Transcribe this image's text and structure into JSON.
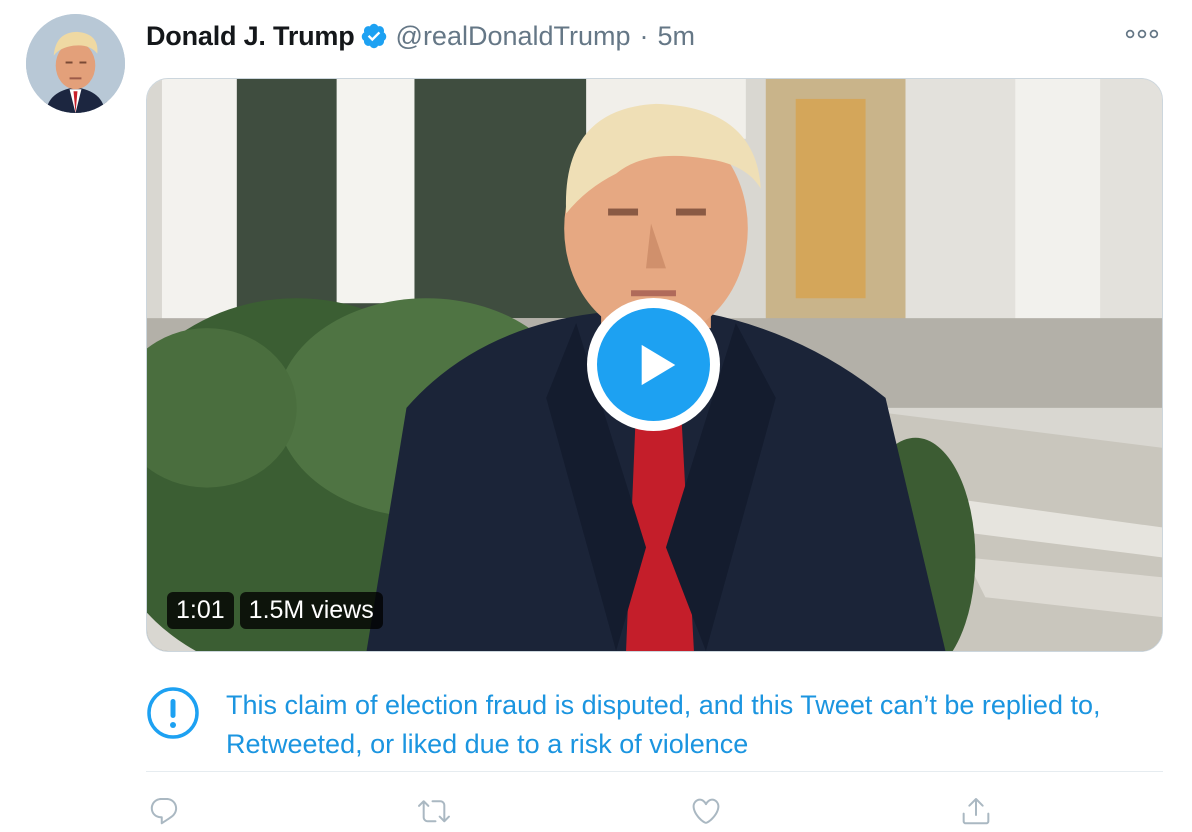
{
  "author": {
    "display_name": "Donald J. Trump",
    "handle": "@realDonaldTrump",
    "separator": "·",
    "time": "5m",
    "verified_icon": "verified-badge-icon"
  },
  "media": {
    "duration": "1:01",
    "views": "1.5M views",
    "play_icon": "play-icon"
  },
  "notice": {
    "icon": "exclamation-circle-icon",
    "text": "This claim of election fraud is disputed, and this Tweet can’t be replied to, Retweeted, or liked due to a risk of violence"
  },
  "actions": [
    {
      "icon": "reply-icon"
    },
    {
      "icon": "retweet-icon"
    },
    {
      "icon": "like-icon"
    },
    {
      "icon": "share-icon"
    }
  ],
  "colors": {
    "brand_blue": "#1da1f2",
    "link_blue": "#1b95e0",
    "muted_gray": "#657786",
    "icon_gray": "#aab8c2"
  }
}
